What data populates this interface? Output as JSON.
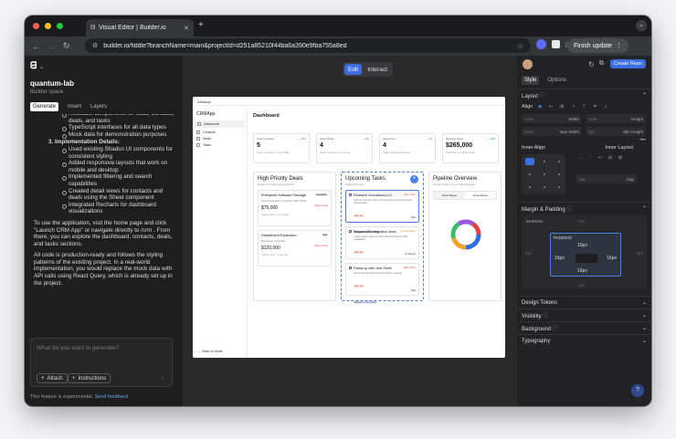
{
  "browser": {
    "tab_title": "Visual Editor | Builder.io",
    "url": "builder.io/fiddle?branchName=main&projectId=d251a85210f44ba6a390e9fba755a8ed",
    "update_label": "Finish update"
  },
  "left": {
    "project": "quantum-lab",
    "space": "Builder space",
    "tabs": [
      "Generate",
      "Insert",
      "Layers"
    ],
    "chat": {
      "b1": "Reusable components for stats, contacts, deals, and tasks",
      "b2": "TypeScript interfaces for all data types",
      "b3": "Mock data for demonstration purposes",
      "heading": "3. Implementation Details:",
      "b4": "Used existing Shadcn UI components for consistent styling",
      "b5": "Added responsive layouts that work on mobile and desktop",
      "b6": "Implemented filtering and search capabilities",
      "b7": "Created detail views for contacts and deals using the Sheet component",
      "b8": "Integrated Recharts for dashboard visualizations",
      "p1": "To use the application, visit the home page and click \"Launch CRM App\" or navigate directly to /crm . From there, you can explore the dashboard, contacts, deals, and tasks sections.",
      "p2": "All code is production-ready and follows the styling patterns of the existing project. In a real-world implementation, you would replace the mock data with API calls using React Query, which is already set up in the project."
    },
    "prompt_placeholder": "What do you want to generate?",
    "attach": "Attach",
    "instructions": "Instructions",
    "experimental": "This feature is experimental.",
    "feedback": "Send feedback"
  },
  "center": {
    "edit": "Edit",
    "interact": "Interact",
    "device": "Desktop",
    "app": {
      "brand": "CRMApp",
      "nav": [
        "Dashboard",
        "Contacts",
        "Deals",
        "Tasks"
      ],
      "back": "Back to Home",
      "title": "Dashboard",
      "stats": [
        {
          "label": "Total Contacts",
          "value": "5",
          "note": "Active contacts in your CRM",
          "change": "+ 12%",
          "color": "#2aa84a"
        },
        {
          "label": "Open Deals",
          "value": "4",
          "note": "Deals currently in progress",
          "change": "+ 8%",
          "color": "#2aa84a"
        },
        {
          "label": "Tasks Due",
          "value": "4",
          "note": "Tasks requiring attention",
          "change": "- 3%",
          "color": "#e04444"
        },
        {
          "label": "Pipeline Value",
          "value": "$265,000",
          "note": "Total value of active deals",
          "change": "+ 18%",
          "color": "#2aa84a"
        }
      ],
      "deals_card": {
        "title": "High Priority Deals",
        "sub": "Deals that need your attention",
        "deals": [
          {
            "name": "Enterprise Software Package",
            "company": "Acme Corporation, Contact: John Smith",
            "amount": "$75,000",
            "priority": "High priority",
            "tag": "negotiation",
            "date": "Closing soon • 1 year ago"
          },
          {
            "name": "Department Expansion",
            "company": "MegaCorp Industries",
            "amount": "$120,000",
            "priority": "High priority",
            "tag": "lead",
            "date": "Closing soon • 1 year ago"
          }
        ]
      },
      "tasks_card": {
        "title": "Upcoming Tasks",
        "sub": "Tasks due soon",
        "tasks": [
          {
            "name": "Research Innovations LLC",
            "desc": "Find out why they didn't proceed and potential for future opportunities",
            "due": "Due now",
            "rel": "Related to Michael Chen",
            "pri": "High priority",
            "st": "Todo"
          },
          {
            "name": "Prepare API integration demo",
            "desc": "Create custom demo for TechStart showing our API capabilities",
            "due": "Due now",
            "rel": "",
            "pri": "medium priority",
            "st": "In progress"
          },
          {
            "name": "Follow up with John Smith",
            "desc": "Send proposal details and schedule a meeting",
            "due": "Due now",
            "rel": "Related to John Smith",
            "pri": "High priority",
            "st": "Todo"
          }
        ]
      },
      "pipeline_card": {
        "title": "Pipeline Overview",
        "sub": "Current state of your sales pipeline",
        "tabs": [
          "Deal Stages",
          "Deal Values"
        ]
      }
    }
  },
  "right": {
    "create": "Create Repo",
    "tabs": [
      "Style",
      "Options"
    ],
    "layout": "Layout",
    "align": "Align",
    "width": "Width",
    "height": "Height",
    "maxw": "Max Width",
    "minh": "Min Height",
    "auto": "Auto",
    "none": "none",
    "zero": "0px",
    "inner_align": "Inner Align",
    "inner_layout": "Inner Layout",
    "gap": "Gap",
    "margin_padding": "Margin & Padding",
    "margin": "MARGIN",
    "padding": "PADDING",
    "p16": "16px",
    "design_tokens": "Design Tokens",
    "visibility": "Visibility",
    "background": "Background",
    "typography": "Typography"
  },
  "colors": {
    "accent": "#3c6ee0",
    "chart": [
      "#2f6fd8",
      "#f0a52a",
      "#3cba6e",
      "#9b59e0",
      "#e04444"
    ]
  }
}
